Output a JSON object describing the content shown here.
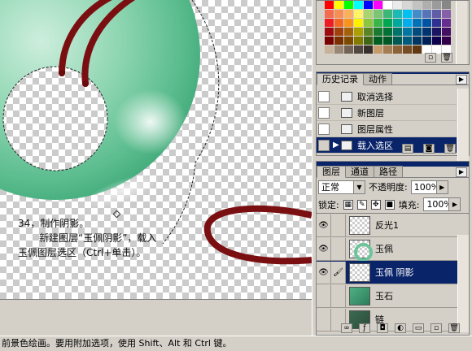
{
  "caption": {
    "line1": "34，制作阴影。",
    "line2": "新建图层“玉佩阴影”，载入",
    "line3": "玉佩图层选区（Ctrl+单击）。"
  },
  "swatch_colors": [
    "#ff0000",
    "#ffff00",
    "#00ff00",
    "#00ffff",
    "#0000ff",
    "#ff00ff",
    "#ffffff",
    "#ebebeb",
    "#d7d7d7",
    "#c3c3c3",
    "#afafaf",
    "#9b9b9b",
    "#878787",
    "#f26c4f",
    "#f68e55",
    "#fbaf5d",
    "#fff467",
    "#acd372",
    "#7cc576",
    "#3bb878",
    "#1abbb4",
    "#00bff3",
    "#438ccb",
    "#5574b9",
    "#605ca8",
    "#855fa8",
    "#ed1c24",
    "#f26522",
    "#f7941d",
    "#fff200",
    "#8dc63f",
    "#39b54a",
    "#00a651",
    "#00a99d",
    "#00aeef",
    "#0072bc",
    "#0054a6",
    "#2e3192",
    "#662d91",
    "#9e0b0f",
    "#a0410d",
    "#a36209",
    "#aba000",
    "#598527",
    "#1a7b30",
    "#007236",
    "#00746b",
    "#0076a3",
    "#004b80",
    "#003471",
    "#1b1464",
    "#440e62",
    "#790000",
    "#7b2e00",
    "#7d4900",
    "#827b00",
    "#406618",
    "#005e20",
    "#005826",
    "#005952",
    "#005b7f",
    "#003663",
    "#002157",
    "#0d004c",
    "#32004b",
    "#c7b299",
    "#998675",
    "#736357",
    "#534741",
    "#37302d",
    "#c69c6d",
    "#a67c52",
    "#8c6239",
    "#754c24",
    "#603913",
    "#fff",
    "#fff",
    "#fff"
  ],
  "history": {
    "tabs": [
      "历史记录",
      "动作"
    ],
    "items": [
      {
        "label": "取消选择",
        "active": false
      },
      {
        "label": "新图层",
        "active": false
      },
      {
        "label": "图层属性",
        "active": false
      },
      {
        "label": "载入选区",
        "active": true
      }
    ]
  },
  "layers": {
    "tabs": [
      "图层",
      "通道",
      "路径"
    ],
    "blend_mode": "正常",
    "opacity_label": "不透明度:",
    "opacity_value": "100%",
    "lock_label": "锁定:",
    "fill_label": "填充:",
    "fill_value": "100%",
    "items": [
      {
        "name": "反光1",
        "visible": true,
        "active": false,
        "thumb": "trans"
      },
      {
        "name": "玉佩",
        "visible": true,
        "active": false,
        "thumb": "jade"
      },
      {
        "name": "玉佩 阴影",
        "visible": true,
        "active": true,
        "thumb": "trans"
      },
      {
        "name": "玉石",
        "visible": false,
        "active": false,
        "thumb": "stone"
      },
      {
        "name": "链",
        "visible": false,
        "active": false,
        "thumb": "green2"
      }
    ]
  },
  "status_text": "前景色绘画。要用附加选项，使用 Shift、Alt 和 Ctrl 键。"
}
